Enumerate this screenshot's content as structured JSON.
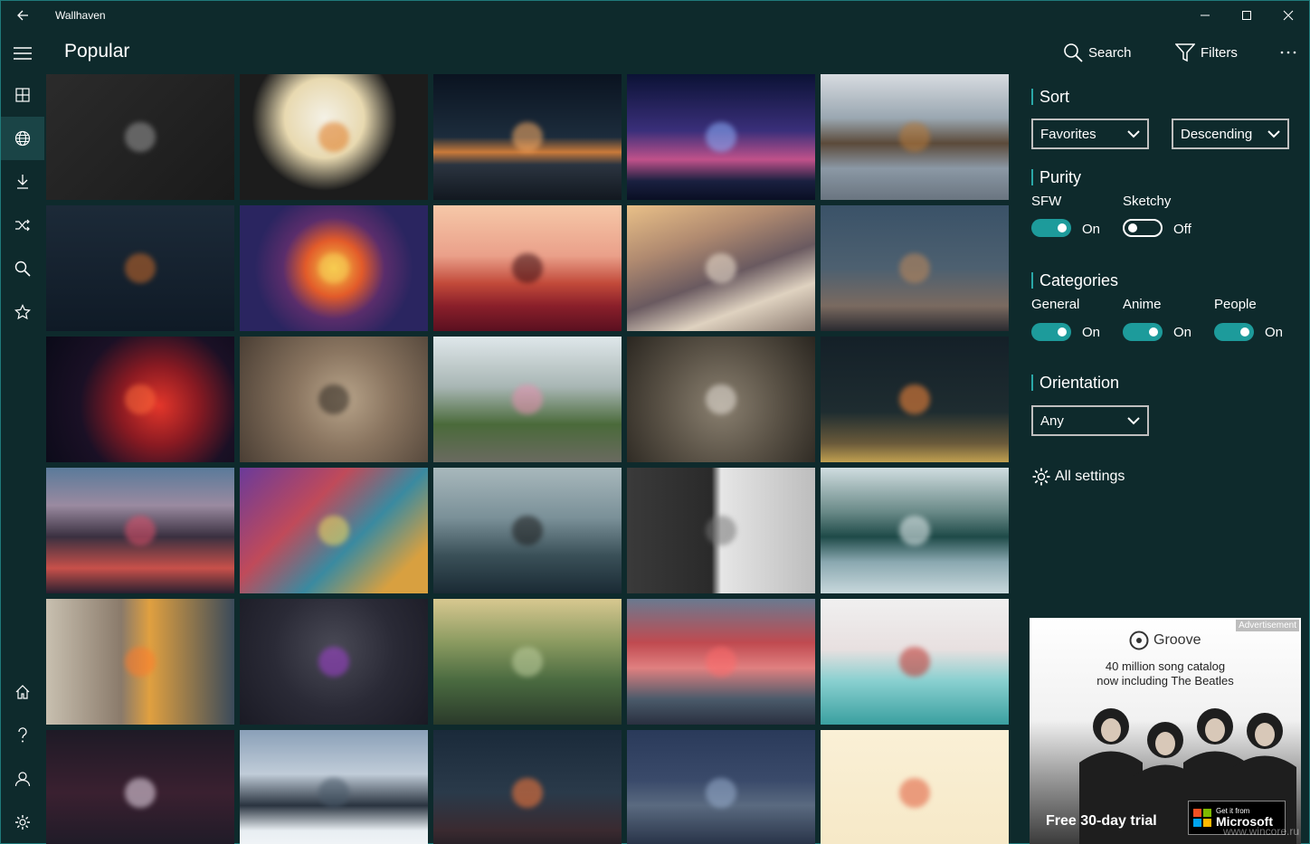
{
  "window": {
    "title": "Wallhaven"
  },
  "header": {
    "title": "Popular",
    "search_label": "Search",
    "filters_label": "Filters"
  },
  "nav": {
    "items": [
      {
        "name": "grid-icon",
        "active": false
      },
      {
        "name": "globe-icon",
        "active": true
      },
      {
        "name": "download-icon",
        "active": false
      },
      {
        "name": "shuffle-icon",
        "active": false
      },
      {
        "name": "search-icon",
        "active": false
      },
      {
        "name": "star-icon",
        "active": false
      }
    ],
    "bottom_items": [
      "home-icon",
      "help-icon",
      "user-icon",
      "settings-icon"
    ]
  },
  "panel": {
    "sort": {
      "title": "Sort",
      "field_value": "Favorites",
      "order_value": "Descending"
    },
    "purity": {
      "title": "Purity",
      "sfw_label": "SFW",
      "sfw_state": "On",
      "sketchy_label": "Sketchy",
      "sketchy_state": "Off"
    },
    "categories": {
      "title": "Categories",
      "general_label": "General",
      "general_state": "On",
      "anime_label": "Anime",
      "anime_state": "On",
      "people_label": "People",
      "people_state": "On"
    },
    "orientation": {
      "title": "Orientation",
      "value": "Any"
    },
    "all_settings_label": "All settings"
  },
  "ad": {
    "tag": "Advertisement",
    "brand": "Groove",
    "line1": "40 million song catalog",
    "line2": "now including The Beatles",
    "cta": "Free 30-day trial",
    "store_small": "Get it from",
    "store_big": "Microsoft",
    "watermark": "www.wincore.ru"
  },
  "thumbnails": [
    {
      "name": "deer-wireframe-thumb",
      "bg": "linear-gradient(135deg,#2b2b2b,#1a1a1a)",
      "accent": "#9a9a9a"
    },
    {
      "name": "planet-tree-thumb",
      "bg": "radial-gradient(circle at 45% 35%,#f4f1e6 0%,#e8d9b0 30%,#1c1c1c 55%)",
      "accent": "#e07a22"
    },
    {
      "name": "volcano-stars-thumb",
      "bg": "linear-gradient(180deg,#0a1320 0%,#1c2c3c 50%,#c97a3a 62%,#2b3440 72%,#121820 100%)",
      "accent": "#ffb066"
    },
    {
      "name": "matterhorn-night-thumb",
      "bg": "linear-gradient(180deg,#0b1235 0%,#3a2f7a 45%,#c0518a 68%,#1a2040 85%,#0a0f24 100%)",
      "accent": "#8fb3ff"
    },
    {
      "name": "lake-mountains-thumb",
      "bg": "linear-gradient(180deg,#d7dbe0 0%,#9aa7b1 35%,#5b4a3a 55%,#8b98a5 75%,#6a7580 100%)",
      "accent": "#b77a3a"
    },
    {
      "name": "solar-system-chart-thumb",
      "bg": "linear-gradient(180deg,#1c2a38,#0f1a26)",
      "accent": "#c96a2a"
    },
    {
      "name": "geometric-fire-thumb",
      "bg": "radial-gradient(circle at 50% 50%,#f6c445 0%,#e25b2a 25%,#5a2d6b 45%,#2a2560 70%)",
      "accent": "#f8d35a"
    },
    {
      "name": "firewatch-thumb",
      "bg": "linear-gradient(180deg,#f6c8a8 0%,#eaa08a 40%,#c24a3a 62%,#8a1f2a 80%,#5a1020 100%)",
      "accent": "#3a0a10"
    },
    {
      "name": "snowy-peaks-thumb",
      "bg": "linear-gradient(160deg,#e9c088 0%,#b08a70 30%,#6a5a60 55%,#dfd2c0 75%,#8a7a70 100%)",
      "accent": "#f3e6d4"
    },
    {
      "name": "dusk-sky-thumb",
      "bg": "linear-gradient(180deg,#3a5268 0%,#4d6070 50%,#7a6a60 80%,#2a2a30 100%)",
      "accent": "#c28a5a"
    },
    {
      "name": "red-nebula-thumb",
      "bg": "radial-gradient(circle at 60% 55%,#e4362a 0%,#8a1a22 30%,#1a1025 60%,#0a0a18 100%)",
      "accent": "#ff6a3a"
    },
    {
      "name": "warrior-dust-thumb",
      "bg": "radial-gradient(circle at 55% 50%,#b8a48a 0%,#8a7560 40%,#4a3e34 100%)",
      "accent": "#2a241e"
    },
    {
      "name": "girl-longboard-thumb",
      "bg": "linear-gradient(180deg,#dfe7ea 0%,#a8b6b4 40%,#4a6a3a 70%,#6a6a60 100%)",
      "accent": "#e890b0"
    },
    {
      "name": "levitation-thumb",
      "bg": "radial-gradient(circle at 50% 55%,#8a8070 0%,#5a5246 50%,#2a2620 100%)",
      "accent": "#e6e0d8"
    },
    {
      "name": "rocket-launch-thumb",
      "bg": "linear-gradient(180deg,#142028 0%,#1e2c30 60%,#6a5a3a 85%,#c0a050 100%)",
      "accent": "#ff8a3a"
    },
    {
      "name": "cherry-cliff-thumb",
      "bg": "linear-gradient(180deg,#5a7a9a 0%,#9a8aa0 30%,#3a3040 55%,#c8504a 80%,#2a2030 100%)",
      "accent": "#e0506a"
    },
    {
      "name": "psychedelic-monster-thumb",
      "bg": "linear-gradient(135deg,#6a3a9a 0%,#c04a5a 35%,#3a8aa0 60%,#d8a040 85%)",
      "accent": "#f0e060"
    },
    {
      "name": "misty-valley-thumb",
      "bg": "linear-gradient(180deg,#a8b8bc 0%,#7a9098 40%,#3a5058 70%,#1a2a34 100%)",
      "accent": "#1a1a1a"
    },
    {
      "name": "siege-soldiers-thumb",
      "bg": "linear-gradient(90deg,#3a3a3a 0%,#2a2a2a 45%,#e6e6e6 50%,#bdbdbd 100%)",
      "accent": "#777777"
    },
    {
      "name": "snowy-forest-lake-thumb",
      "bg": "linear-gradient(180deg,#d0dde0 0%,#6a8a88 35%,#1e4a48 55%,#8aa8b0 75%,#c8d8dc 100%)",
      "accent": "#eaf2f4"
    },
    {
      "name": "astronaut-fire-thumb",
      "bg": "linear-gradient(90deg,#c8c0b0 0%,#8a7a6a 40%,#e0a040 55%,#3a4a5a 100%)",
      "accent": "#ff7a2a"
    },
    {
      "name": "woman-water-thumb",
      "bg": "radial-gradient(circle at 50% 40%,#4a4a56 0%,#2a2a36 50%,#1a1a24 100%)",
      "accent": "#a040d0"
    },
    {
      "name": "foggy-forest-thumb",
      "bg": "linear-gradient(180deg,#d8c890 0%,#8a9a60 35%,#4a6a40 65%,#2a3a2a 100%)",
      "accent": "#c0d0a0"
    },
    {
      "name": "red-tree-thumb",
      "bg": "linear-gradient(180deg,#6a7a90 0%,#c04a50 35%,#e08080 55%,#4a5a6a 80%,#2a3040 100%)",
      "accent": "#ff6a6a"
    },
    {
      "name": "lowpoly-vortex-thumb",
      "bg": "linear-gradient(180deg,#f0f0f0 0%,#e8e0e0 40%,#8ad0d0 65%,#3aa0a0 100%)",
      "accent": "#c0302a"
    },
    {
      "name": "anime-swordswoman-thumb",
      "bg": "linear-gradient(180deg,#1e1a26 0%,#3a2030 50%,#1a1a26 100%)",
      "accent": "#f0e0f0"
    },
    {
      "name": "mountain-range-thumb",
      "bg": "linear-gradient(180deg,#8aa0b8 0%,#c0ccd8 35%,#2a3440 60%,#e8eef2 80%,#f6f8fa 100%)",
      "accent": "#4a5a6a"
    },
    {
      "name": "lanterns-warrior-thumb",
      "bg": "linear-gradient(180deg,#1a2a3a 0%,#2a3a4a 50%,#3a2a30 80%,#1a1a20 100%)",
      "accent": "#ff7a3a"
    },
    {
      "name": "night-castle-thumb",
      "bg": "linear-gradient(180deg,#2a3a5a 0%,#3a4a6a 40%,#5a6a80 60%,#1a2438 100%)",
      "accent": "#9ab0d0"
    },
    {
      "name": "cute-critters-thumb",
      "bg": "linear-gradient(180deg,#faf0d6,#f6e8c6)",
      "accent": "#e05a3a"
    }
  ]
}
